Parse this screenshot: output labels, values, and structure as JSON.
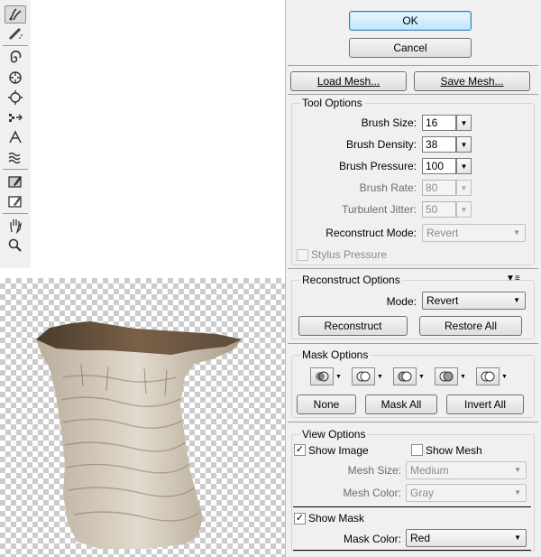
{
  "toolbar": {
    "tools": [
      {
        "icon": "forward-warp-icon",
        "active": true
      },
      {
        "icon": "reconstruct-brush-icon"
      },
      {
        "icon": "twirl-icon"
      },
      {
        "icon": "pucker-icon"
      },
      {
        "icon": "bloat-icon"
      },
      {
        "icon": "push-left-icon"
      },
      {
        "icon": "mirror-icon"
      },
      {
        "icon": "turbulence-icon"
      },
      {
        "icon": "freeze-mask-icon"
      },
      {
        "icon": "thaw-mask-icon"
      },
      {
        "icon": "hand-icon"
      },
      {
        "icon": "zoom-icon"
      }
    ]
  },
  "dialog": {
    "ok_label": "OK",
    "cancel_label": "Cancel",
    "load_mesh_label": "Load Mesh...",
    "save_mesh_label": "Save Mesh..."
  },
  "tool_options": {
    "title": "Tool Options",
    "brush_size": {
      "label": "Brush Size:",
      "value": "16"
    },
    "brush_density": {
      "label": "Brush Density:",
      "value": "38"
    },
    "brush_pressure": {
      "label": "Brush Pressure:",
      "value": "100"
    },
    "brush_rate": {
      "label": "Brush Rate:",
      "value": "80"
    },
    "turbulent_jitter": {
      "label": "Turbulent Jitter:",
      "value": "50"
    },
    "reconstruct_mode": {
      "label": "Reconstruct Mode:",
      "value": "Revert"
    },
    "stylus_pressure": {
      "label": "Stylus Pressure",
      "checked": false
    }
  },
  "reconstruct_options": {
    "title": "Reconstruct Options",
    "mode_label": "Mode:",
    "mode_value": "Revert",
    "reconstruct_label": "Reconstruct",
    "restore_all_label": "Restore All"
  },
  "mask_options": {
    "title": "Mask Options",
    "none_label": "None",
    "mask_all_label": "Mask All",
    "invert_all_label": "Invert All"
  },
  "view_options": {
    "title": "View Options",
    "show_image": {
      "label": "Show Image",
      "checked": true
    },
    "show_mesh": {
      "label": "Show Mesh",
      "checked": false
    },
    "mesh_size": {
      "label": "Mesh Size:",
      "value": "Medium"
    },
    "mesh_color": {
      "label": "Mesh Color:",
      "value": "Gray"
    },
    "show_mask": {
      "label": "Show Mask",
      "checked": true
    },
    "mask_color": {
      "label": "Mask Color:",
      "value": "Red"
    }
  },
  "colors": {
    "ok_button_bg": "#bee6fd",
    "panel_bg": "#f0f0f0",
    "checker": "#cccccc"
  }
}
